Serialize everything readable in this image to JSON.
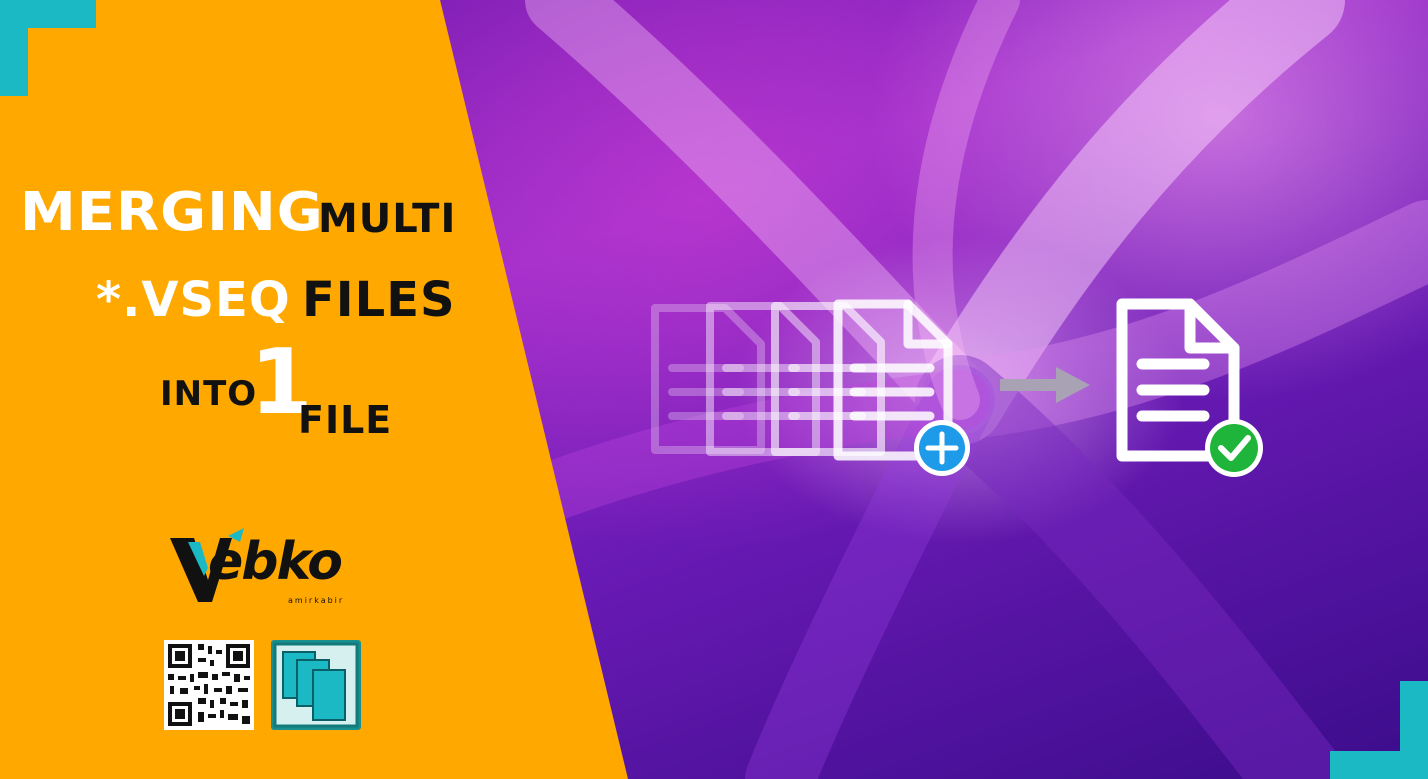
{
  "title": {
    "line1_big": "MERGING",
    "line1_small": "MULTI",
    "line2_white": "*.VSEQ",
    "line2_black": "FILES",
    "line3_into": "INTO",
    "line3_number": "1",
    "line3_file": "FILE"
  },
  "logo": {
    "wordmark": "ebko",
    "tagline": "amirkabir"
  },
  "colors": {
    "orange": "#ffa800",
    "teal": "#1bb9c4",
    "plus_badge": "#1e9be8",
    "check_badge": "#1fb53a"
  },
  "icons": {
    "source_files": "stacked-documents-icon",
    "add": "plus-icon",
    "arrow": "arrow-right-icon",
    "result_file": "document-icon",
    "done": "check-icon"
  }
}
